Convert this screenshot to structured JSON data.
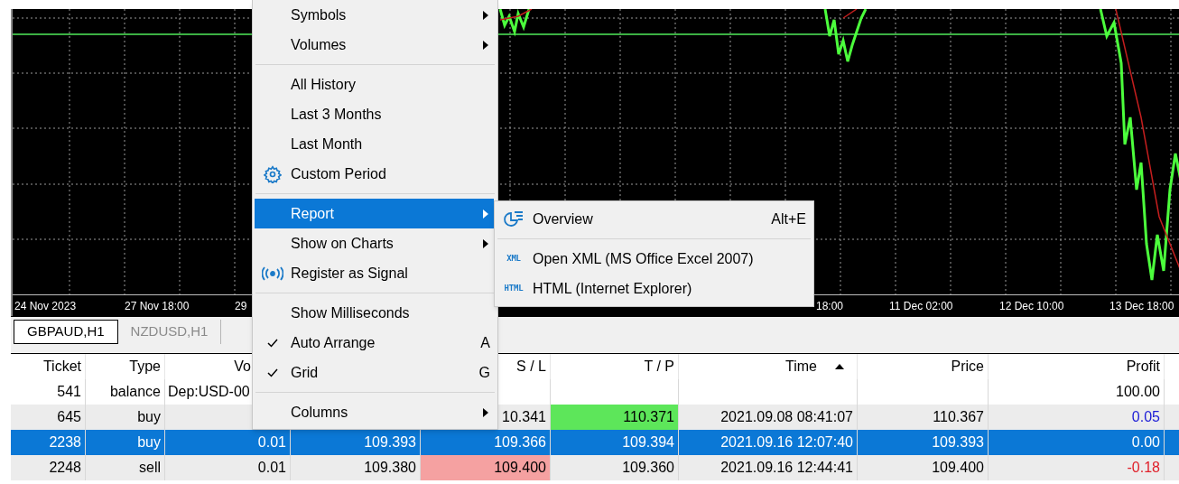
{
  "chart": {
    "left_labels": [
      "24 Nov 2023",
      "27 Nov 18:00",
      "29"
    ],
    "right_labels": [
      "18:00",
      "11 Dec 02:00",
      "12 Dec 10:00",
      "13 Dec 18:00"
    ]
  },
  "tabs": [
    {
      "label": "GBPAUD,H1",
      "selected": true
    },
    {
      "label": "NZDUSD,H1",
      "selected": false
    }
  ],
  "table": {
    "headers": [
      {
        "label": "Ticket",
        "sort_ascending": false
      },
      {
        "label": "Type",
        "sort_ascending": false
      },
      {
        "label": "Vo",
        "sort_ascending": false
      },
      {
        "label": "S / L",
        "sort_ascending": false
      },
      {
        "label": "T / P",
        "sort_ascending": false
      },
      {
        "label": "Time",
        "sort_ascending": true
      },
      {
        "label": "Price",
        "sort_ascending": false
      },
      {
        "label": "Profit",
        "sort_ascending": false
      }
    ],
    "rows": [
      {
        "kind": "balance",
        "selected": false,
        "ticket": "541",
        "type": "balance",
        "comment": "Dep:USD-00",
        "profit": {
          "text": "100.00"
        }
      },
      {
        "kind": "deal",
        "selected": false,
        "sl_reached": false,
        "tp_reached": true,
        "ticket": "645",
        "type": "buy",
        "sl": "10.341",
        "tp": "110.371",
        "time": "2021.09.08 08:41:07",
        "price_close": "110.367",
        "profit": {
          "text": "0.05",
          "color": "#1c1cd6"
        }
      },
      {
        "kind": "deal",
        "selected": true,
        "sl_reached": false,
        "tp_reached": false,
        "ticket": "2238",
        "type": "buy",
        "volume": "0.01",
        "price": "109.393",
        "sl": "109.366",
        "tp": "109.394",
        "time": "2021.09.16 12:07:40",
        "price_close": "109.393",
        "profit": {
          "text": "0.00"
        }
      },
      {
        "kind": "deal",
        "selected": false,
        "sl_reached": true,
        "tp_reached": false,
        "ticket": "2248",
        "type": "sell",
        "volume": "0.01",
        "price": "109.380",
        "sl": "109.400",
        "tp": "109.360",
        "time": "2021.09.16 12:44:41",
        "price_close": "109.400",
        "profit": {
          "text": "-0.18",
          "color": "#e0202a"
        }
      }
    ]
  },
  "context_menu": {
    "items": [
      {
        "kind": "item",
        "label": "Symbols",
        "submenu": true,
        "selected": false,
        "checked": false
      },
      {
        "kind": "item",
        "label": "Volumes",
        "submenu": true,
        "selected": false,
        "checked": false
      },
      {
        "kind": "separator"
      },
      {
        "kind": "item",
        "label": "All History",
        "submenu": false,
        "selected": false,
        "checked": false
      },
      {
        "kind": "item",
        "label": "Last 3 Months",
        "submenu": false,
        "selected": false,
        "checked": false
      },
      {
        "kind": "item",
        "label": "Last Month",
        "submenu": false,
        "selected": false,
        "checked": false
      },
      {
        "kind": "gear_item",
        "label": "Custom Period",
        "submenu": false,
        "selected": false,
        "checked": false
      },
      {
        "kind": "separator"
      },
      {
        "kind": "item",
        "label": "Report",
        "submenu": true,
        "selected": true,
        "checked": false
      },
      {
        "kind": "item",
        "label": "Show on Charts",
        "submenu": true,
        "selected": false,
        "checked": false
      },
      {
        "kind": "signal_item",
        "label": "Register as Signal",
        "submenu": false,
        "selected": false,
        "checked": false
      },
      {
        "kind": "separator"
      },
      {
        "kind": "item",
        "label": "Show Milliseconds",
        "submenu": false,
        "selected": false,
        "checked": false
      },
      {
        "kind": "item",
        "label": "Auto Arrange",
        "shortcut": "A",
        "submenu": false,
        "selected": false,
        "checked": true
      },
      {
        "kind": "item",
        "label": "Grid",
        "shortcut": "G",
        "submenu": false,
        "selected": false,
        "checked": true
      },
      {
        "kind": "separator"
      },
      {
        "kind": "item",
        "label": "Columns",
        "submenu": true,
        "selected": false,
        "checked": false
      }
    ]
  },
  "report_submenu": {
    "items": [
      {
        "kind": "chart_item",
        "label": "Overview",
        "shortcut": "Alt+E"
      },
      {
        "kind": "separator"
      },
      {
        "kind": "file_item",
        "label": "Open XML (MS Office Excel 2007)",
        "badge": "XML"
      },
      {
        "kind": "file_item",
        "label": "HTML (Internet Explorer)",
        "badge": "HTML"
      }
    ]
  }
}
